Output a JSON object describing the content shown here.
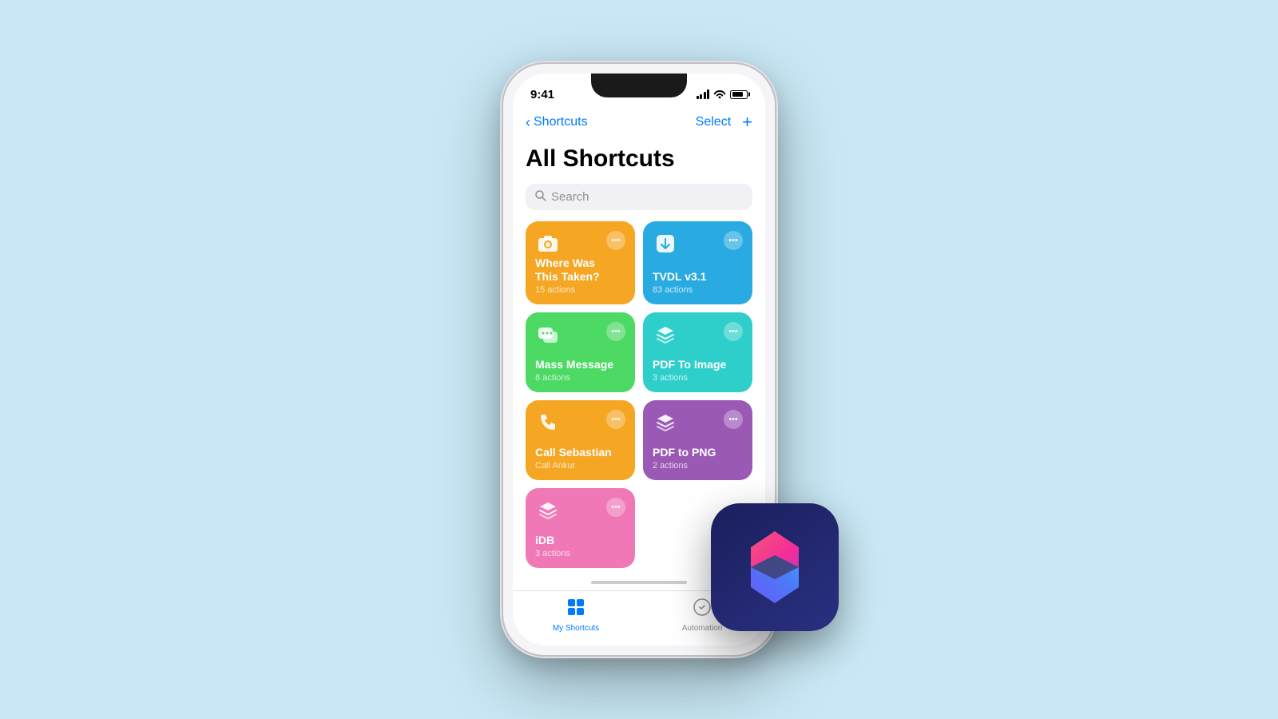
{
  "status_bar": {
    "time": "9:41"
  },
  "nav": {
    "back_label": "Shortcuts",
    "select_label": "Select",
    "plus_label": "+"
  },
  "page": {
    "title": "All Shortcuts"
  },
  "search": {
    "placeholder": "Search"
  },
  "shortcuts": [
    {
      "id": "where-was-taken",
      "name": "Where Was This Taken?",
      "actions": "15 actions",
      "color": "card-yellow",
      "icon": "camera"
    },
    {
      "id": "tvdl",
      "name": "TVDL v3.1",
      "actions": "83 actions",
      "color": "card-blue",
      "icon": "download"
    },
    {
      "id": "mass-message",
      "name": "Mass Message",
      "actions": "8 actions",
      "color": "card-green",
      "icon": "message"
    },
    {
      "id": "pdf-to-image",
      "name": "PDF To Image",
      "actions": "3 actions",
      "color": "card-teal",
      "icon": "layers"
    },
    {
      "id": "call-sebastian",
      "name": "Call Sebastian",
      "actions": "Call Ankur",
      "color": "card-yellow2",
      "icon": "phone"
    },
    {
      "id": "pdf-to-png",
      "name": "PDF to PNG",
      "actions": "2 actions",
      "color": "card-purple",
      "icon": "layers"
    },
    {
      "id": "idb",
      "name": "iDB",
      "actions": "3 actions",
      "color": "card-pink",
      "icon": "layers"
    }
  ],
  "tabs": [
    {
      "id": "my-shortcuts",
      "label": "My Shortcuts",
      "active": true
    },
    {
      "id": "automation",
      "label": "Automation",
      "active": false
    }
  ]
}
